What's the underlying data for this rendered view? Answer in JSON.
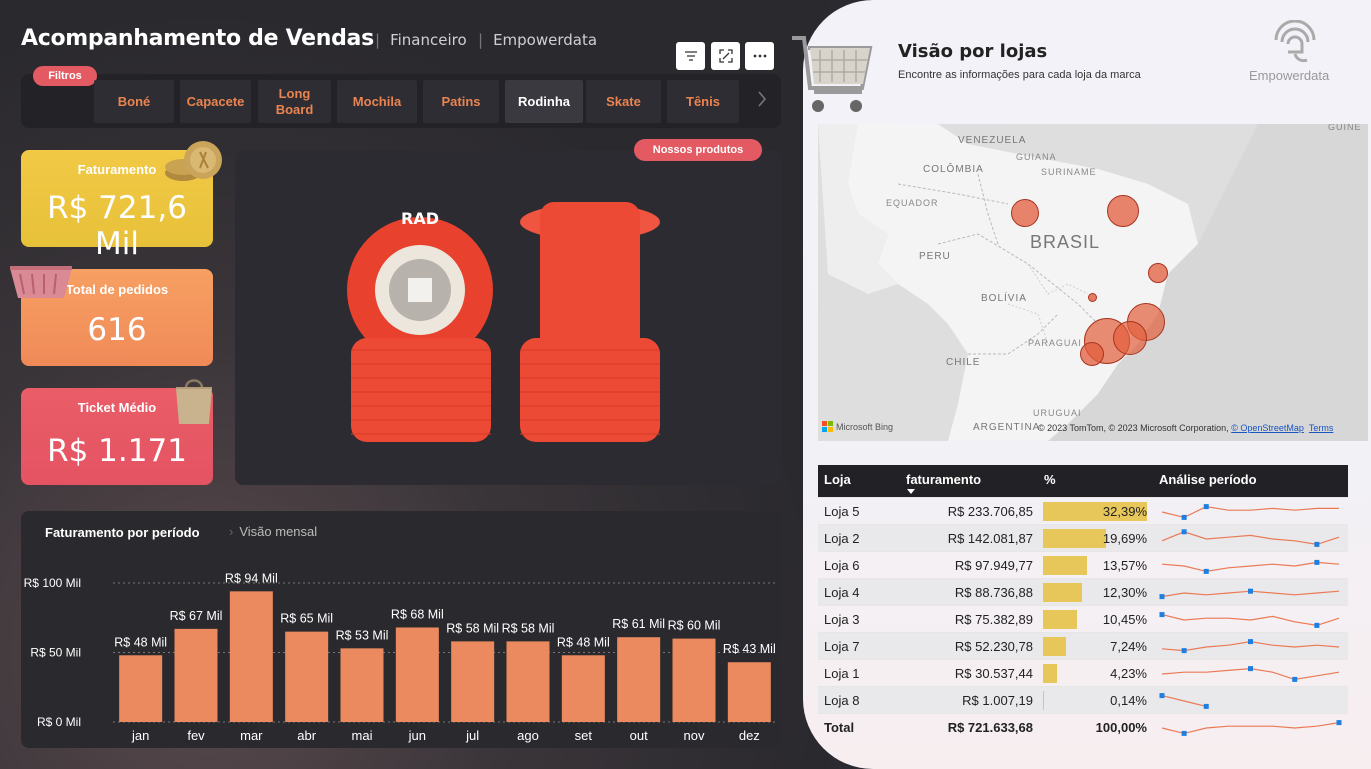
{
  "header": {
    "title": "Acompanhamento de Vendas",
    "nav1": "Financeiro",
    "nav2": "Empowerdata"
  },
  "filters": {
    "label": "Filtros",
    "items": [
      {
        "label": "Boné"
      },
      {
        "label": "Capacete"
      },
      {
        "label": "Long Board"
      },
      {
        "label": "Mochila"
      },
      {
        "label": "Patins"
      },
      {
        "label": "Rodinha"
      },
      {
        "label": "Skate"
      },
      {
        "label": "Tênis"
      }
    ],
    "active": "Rodinha"
  },
  "kpis": {
    "faturamento": {
      "label": "Faturamento",
      "value": "R$ 721,6 Mil"
    },
    "pedidos": {
      "label": "Total de pedidos",
      "value": "616"
    },
    "ticket": {
      "label": "Ticket Médio",
      "value": "R$ 1.171"
    }
  },
  "product": {
    "badge": "Nossos produtos",
    "brand": "RAD"
  },
  "chart": {
    "title": "Faturamento por período",
    "subtitle": "Visão mensal"
  },
  "chart_data": {
    "type": "bar",
    "categories": [
      "jan",
      "fev",
      "mar",
      "abr",
      "mai",
      "jun",
      "jul",
      "ago",
      "set",
      "out",
      "nov",
      "dez"
    ],
    "values": [
      48,
      67,
      94,
      65,
      53,
      68,
      58,
      58,
      48,
      61,
      60,
      43
    ],
    "data_labels": [
      "R$ 48 Mil",
      "R$ 67 Mil",
      "R$ 94 Mil",
      "R$ 65 Mil",
      "R$ 53 Mil",
      "R$ 68 Mil",
      "R$ 58 Mil",
      "R$ 58 Mil",
      "R$ 48 Mil",
      "R$ 61 Mil",
      "R$ 60 Mil",
      "R$ 43 Mil"
    ],
    "yticks": [
      {
        "v": 0,
        "label": "R$ 0 Mil"
      },
      {
        "v": 50,
        "label": "R$ 50 Mil"
      },
      {
        "v": 100,
        "label": "R$ 100 Mil"
      }
    ],
    "ylim": [
      0,
      100
    ],
    "color": "#ea8a5e"
  },
  "right": {
    "title": "Visão por lojas",
    "subtitle": "Encontre as informações para cada loja da marca",
    "logo": "Empowerdata"
  },
  "map": {
    "labels": {
      "venezuela": "VENEZUELA",
      "guiana": "GUIANA",
      "suriname": "SURINAME",
      "guine": "GUINÉ",
      "colombia": "COLÔMBIA",
      "equador": "EQUADOR",
      "brasil": "BRASIL",
      "peru": "PERU",
      "bolivia": "BOLÍVIA",
      "paraguai": "PARAGUAI",
      "chile": "CHILE",
      "uruguai": "URUGUAI",
      "argentina": "ARGENTINA"
    },
    "bing": "Microsoft Bing",
    "copyright": "© 2023 TomTom, © 2023 Microsoft Corporation,",
    "osm": "© OpenStreetMap",
    "terms": "Terms"
  },
  "table": {
    "headers": {
      "loja": "Loja",
      "fat": "faturamento",
      "pct": "%",
      "periodo": "Análise período"
    },
    "rows": [
      {
        "loja": "Loja 5",
        "fat": "R$ 233.706,85",
        "pct": "32,39%",
        "p": 32.39,
        "spark": [
          0.5,
          0.2,
          0.8,
          0.6,
          0.6,
          0.7,
          0.6,
          0.7,
          0.7
        ]
      },
      {
        "loja": "Loja 2",
        "fat": "R$ 142.081,87",
        "pct": "19,69%",
        "p": 19.69,
        "spark": [
          0.4,
          0.9,
          0.5,
          0.6,
          0.7,
          0.5,
          0.4,
          0.2,
          0.6
        ]
      },
      {
        "loja": "Loja 6",
        "fat": "R$ 97.949,77",
        "pct": "13,57%",
        "p": 13.57,
        "spark": [
          0.6,
          0.5,
          0.2,
          0.4,
          0.5,
          0.6,
          0.5,
          0.7,
          0.6
        ]
      },
      {
        "loja": "Loja 4",
        "fat": "R$ 88.736,88",
        "pct": "12,30%",
        "p": 12.3,
        "spark": [
          0.3,
          0.5,
          0.4,
          0.5,
          0.6,
          0.5,
          0.4,
          0.5,
          0.6
        ]
      },
      {
        "loja": "Loja 3",
        "fat": "R$ 75.382,89",
        "pct": "10,45%",
        "p": 10.45,
        "spark": [
          0.8,
          0.5,
          0.6,
          0.6,
          0.5,
          0.7,
          0.4,
          0.2,
          0.6
        ]
      },
      {
        "loja": "Loja 7",
        "fat": "R$ 52.230,78",
        "pct": "7,24%",
        "p": 7.24,
        "spark": [
          0.4,
          0.3,
          0.5,
          0.6,
          0.8,
          0.6,
          0.5,
          0.6,
          0.5
        ]
      },
      {
        "loja": "Loja 1",
        "fat": "R$ 30.537,44",
        "pct": "4,23%",
        "p": 4.23,
        "spark": [
          0.5,
          0.6,
          0.6,
          0.7,
          0.8,
          0.6,
          0.2,
          0.4,
          0.6
        ]
      },
      {
        "loja": "Loja 8",
        "fat": "R$ 1.007,19",
        "pct": "0,14%",
        "p": 0.14,
        "spark": [
          0.8,
          0.5,
          0.2
        ]
      }
    ],
    "total": {
      "loja": "Total",
      "fat": "R$ 721.633,68",
      "pct": "100,00%",
      "spark": [
        0.5,
        0.2,
        0.5,
        0.6,
        0.6,
        0.6,
        0.5,
        0.6,
        0.8
      ]
    }
  }
}
